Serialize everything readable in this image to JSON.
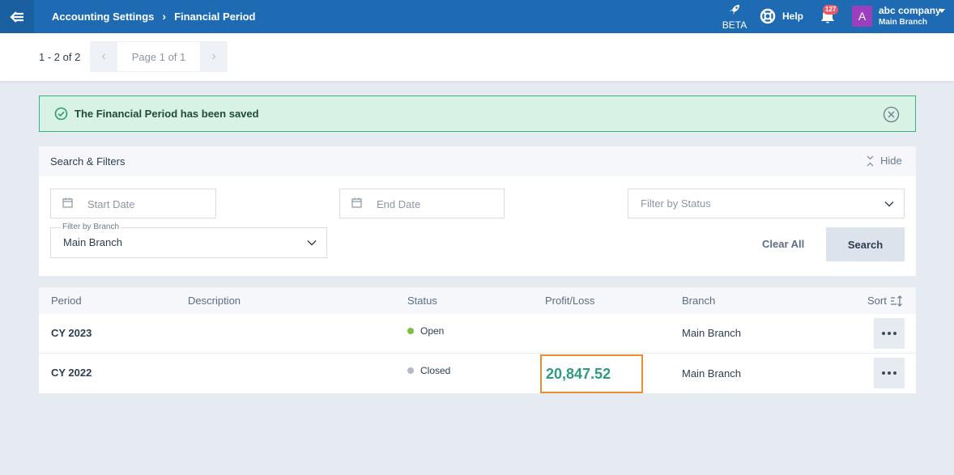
{
  "header": {
    "breadcrumb": [
      "Accounting Settings",
      "Financial Period"
    ],
    "beta_label": "BETA",
    "help_label": "Help",
    "notification_count": "127",
    "avatar_letter": "A",
    "company_name": "abc company",
    "company_branch": "Main Branch"
  },
  "pagination": {
    "range": "1 - 2 of 2",
    "page_label": "Page 1 of 1"
  },
  "alert": {
    "message": "The Financial Period has been saved"
  },
  "filters": {
    "title": "Search & Filters",
    "hide_label": "Hide",
    "start_date_placeholder": "Start Date",
    "end_date_placeholder": "End Date",
    "status_placeholder": "Filter by Status",
    "branch_label": "Filter by Branch",
    "branch_value": "Main Branch",
    "clear_label": "Clear All",
    "search_label": "Search"
  },
  "table": {
    "columns": [
      "Period",
      "Description",
      "Status",
      "Profit/Loss",
      "Branch",
      "Sort"
    ],
    "rows": [
      {
        "period": "CY 2023",
        "description": "",
        "status": "Open",
        "status_color": "#7cc142",
        "profit_loss": "",
        "branch": "Main Branch"
      },
      {
        "period": "CY 2022",
        "description": "",
        "status": "Closed",
        "status_color": "#b4b8c9",
        "profit_loss": "20,847.52",
        "branch": "Main Branch"
      }
    ]
  },
  "colors": {
    "topbar": "#1e6bb3",
    "success_bg": "#d8f3e6",
    "success_border": "#38b47a",
    "highlight": "#f08a2c",
    "profit": "#2e9a7e"
  }
}
